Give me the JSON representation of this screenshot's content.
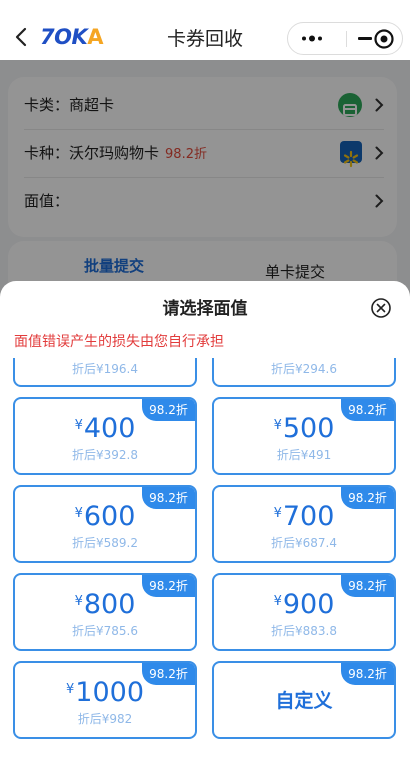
{
  "header": {
    "logo_part1": "7OK",
    "logo_part2": "A",
    "title": "卡券回收"
  },
  "form": {
    "category_label": "卡类：",
    "category_value": "商超卡",
    "type_label": "卡种：",
    "type_value": "沃尔玛购物卡",
    "type_discount": "98.2折",
    "denomination_label": "面值："
  },
  "tabs": {
    "batch": "批量提交",
    "single": "单卡提交"
  },
  "sheet": {
    "title": "请选择面值",
    "warning": "面值错误产生的损失由您自行承担",
    "currency": "¥",
    "partial_row": [
      "折后¥196.4",
      "折后¥294.6"
    ],
    "options": [
      {
        "badge": "98.2折",
        "amount": "400",
        "after": "折后¥392.8"
      },
      {
        "badge": "98.2折",
        "amount": "500",
        "after": "折后¥491"
      },
      {
        "badge": "98.2折",
        "amount": "600",
        "after": "折后¥589.2"
      },
      {
        "badge": "98.2折",
        "amount": "700",
        "after": "折后¥687.4"
      },
      {
        "badge": "98.2折",
        "amount": "800",
        "after": "折后¥785.6"
      },
      {
        "badge": "98.2折",
        "amount": "900",
        "after": "折后¥883.8"
      },
      {
        "badge": "98.2折",
        "amount": "1000",
        "after": "折后¥982"
      }
    ],
    "custom": {
      "badge": "98.2折",
      "label": "自定义"
    }
  },
  "icons": {
    "back": "chevron-left-icon",
    "more": "more-dots-icon",
    "minimize": "minimize-icon",
    "close_mini": "target-close-icon",
    "sheet_close": "circle-x-icon"
  },
  "colors": {
    "accent": "#2f8aea",
    "warning": "#e23c3c",
    "brand_blue": "#1f4fc4",
    "brand_orange": "#f5a623"
  }
}
